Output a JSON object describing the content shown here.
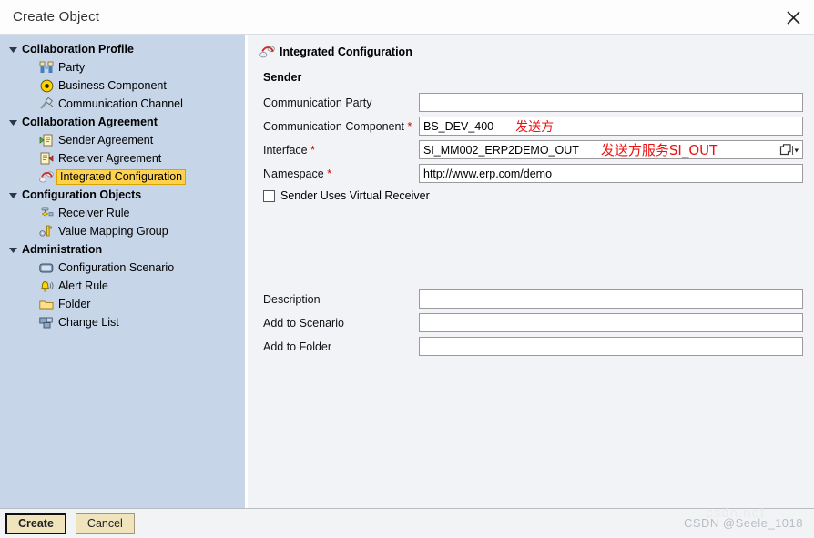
{
  "window": {
    "title": "Create Object",
    "close_icon": "close-icon"
  },
  "sidebar": {
    "groups": [
      {
        "label": "Collaboration Profile",
        "items": [
          {
            "label": "Party",
            "icon": "party-icon"
          },
          {
            "label": "Business Component",
            "icon": "business-component-icon"
          },
          {
            "label": "Communication Channel",
            "icon": "communication-channel-icon"
          }
        ]
      },
      {
        "label": "Collaboration Agreement",
        "items": [
          {
            "label": "Sender Agreement",
            "icon": "sender-agreement-icon"
          },
          {
            "label": "Receiver Agreement",
            "icon": "receiver-agreement-icon"
          },
          {
            "label": "Integrated Configuration",
            "icon": "integrated-configuration-icon",
            "selected": true
          }
        ]
      },
      {
        "label": "Configuration Objects",
        "items": [
          {
            "label": "Receiver Rule",
            "icon": "receiver-rule-icon"
          },
          {
            "label": "Value Mapping Group",
            "icon": "value-mapping-group-icon"
          }
        ]
      },
      {
        "label": "Administration",
        "items": [
          {
            "label": "Configuration Scenario",
            "icon": "configuration-scenario-icon"
          },
          {
            "label": "Alert Rule",
            "icon": "alert-rule-icon"
          },
          {
            "label": "Folder",
            "icon": "folder-icon"
          },
          {
            "label": "Change List",
            "icon": "change-list-icon"
          }
        ]
      }
    ]
  },
  "content": {
    "object_title": "Integrated Configuration",
    "object_icon": "integrated-configuration-icon",
    "sender_section": "Sender",
    "fields": {
      "communication_party": {
        "label": "Communication Party",
        "required": false,
        "value": "",
        "placeholder": ""
      },
      "communication_component": {
        "label": "Communication Component",
        "required": true,
        "value": "BS_DEV_400",
        "placeholder": "",
        "annotation": "发送方"
      },
      "interface": {
        "label": "Interface",
        "required": true,
        "value": "SI_MM002_ERP2DEMO_OUT",
        "placeholder": "",
        "annotation": "发送方服务SI_OUT",
        "help_icon": "value-help-icon"
      },
      "namespace": {
        "label": "Namespace",
        "required": true,
        "value": "http://www.erp.com/demo",
        "placeholder": ""
      },
      "description": {
        "label": "Description",
        "required": false,
        "value": "",
        "placeholder": ""
      },
      "add_to_scenario": {
        "label": "Add to Scenario",
        "required": false,
        "value": "",
        "placeholder": ""
      },
      "add_to_folder": {
        "label": "Add to Folder",
        "required": false,
        "value": "",
        "placeholder": ""
      }
    },
    "checkbox": {
      "label": "Sender Uses Virtual Receiver",
      "checked": false
    }
  },
  "footer": {
    "create_label": "Create",
    "cancel_label": "Cancel",
    "watermark": "CSDN @Seele_1018",
    "watermark_bg": "csdn.net"
  },
  "colors": {
    "sidebar_bg": "#c6d5e8",
    "content_bg": "#f2f3f7",
    "titlebar_bg": "#fdfdfd",
    "selection": "#ffd24d",
    "required_asterisk": "#cc0000",
    "annotation_red": "#ee1111",
    "button_bg": "#f0e4bd",
    "watermark": "#b9bec6"
  }
}
